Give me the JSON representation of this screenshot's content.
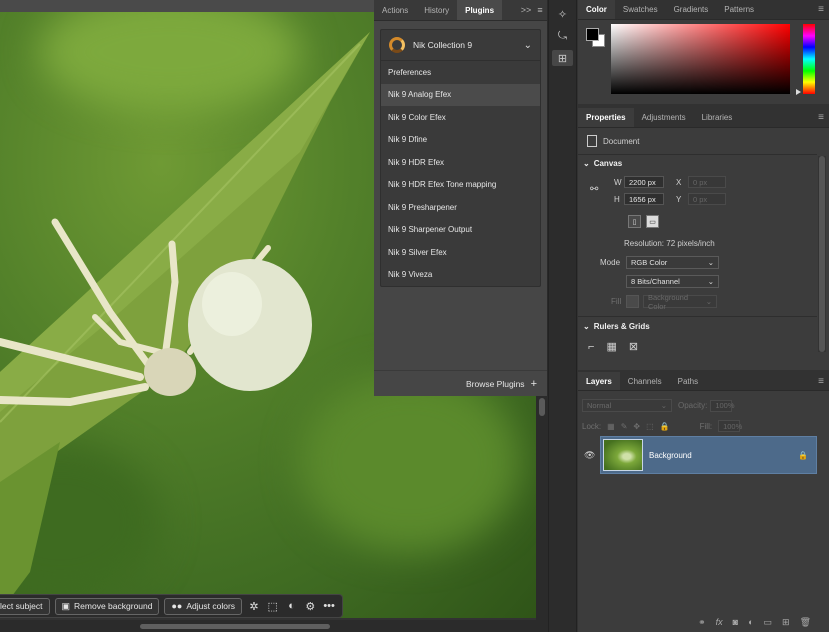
{
  "plugins_panel": {
    "tabs": [
      "Actions",
      "History",
      "Plugins"
    ],
    "active_tab": "Plugins",
    "selected_plugin": "Nik Collection 9",
    "items": [
      "Preferences",
      "Nik 9 Analog Efex",
      "Nik 9 Color Efex",
      "Nik 9 Dfine",
      "Nik 9 HDR Efex",
      "Nik 9 HDR Efex Tone mapping",
      "Nik 9 Presharpener",
      "Nik 9 Sharpener Output",
      "Nik 9 Silver Efex",
      "Nik 9 Viveza"
    ],
    "hover_index": 1,
    "browse_label": "Browse Plugins",
    "browse_icon": "+"
  },
  "color_panel": {
    "tabs": [
      "Color",
      "Swatches",
      "Gradients",
      "Patterns"
    ],
    "foreground": "#000000",
    "background": "#ffffff",
    "hue_color": "#ff0000"
  },
  "properties_panel": {
    "tabs": [
      "Properties",
      "Adjustments",
      "Libraries"
    ],
    "document_label": "Document",
    "canvas_section": "Canvas",
    "w_label": "W",
    "w_value": "2200 px",
    "h_label": "H",
    "h_value": "1656 px",
    "x_label": "X",
    "x_value": "0 px",
    "y_label": "Y",
    "y_value": "0 px",
    "resolution": "Resolution: 72 pixels/inch",
    "mode_label": "Mode",
    "mode_value": "RGB Color",
    "depth_value": "8 Bits/Channel",
    "fill_label": "Fill",
    "fill_value": "Background Color",
    "rulers_section": "Rulers & Grids"
  },
  "layers_panel": {
    "tabs": [
      "Layers",
      "Channels",
      "Paths"
    ],
    "blend_mode": "Normal",
    "opacity_label": "Opacity:",
    "opacity_value": "100%",
    "lock_label": "Lock:",
    "fill_label": "Fill:",
    "fill_value": "100%",
    "layer_name": "Background"
  },
  "taskbar": {
    "select_subject": "lect subject",
    "remove_background": "Remove background",
    "adjust_colors": "Adjust colors",
    "more": "•••"
  },
  "icons": {
    "panel_menu": "≡",
    "collapse": ">>",
    "chevron_down": "⌄",
    "eye": "👁",
    "lock": "🔒"
  }
}
